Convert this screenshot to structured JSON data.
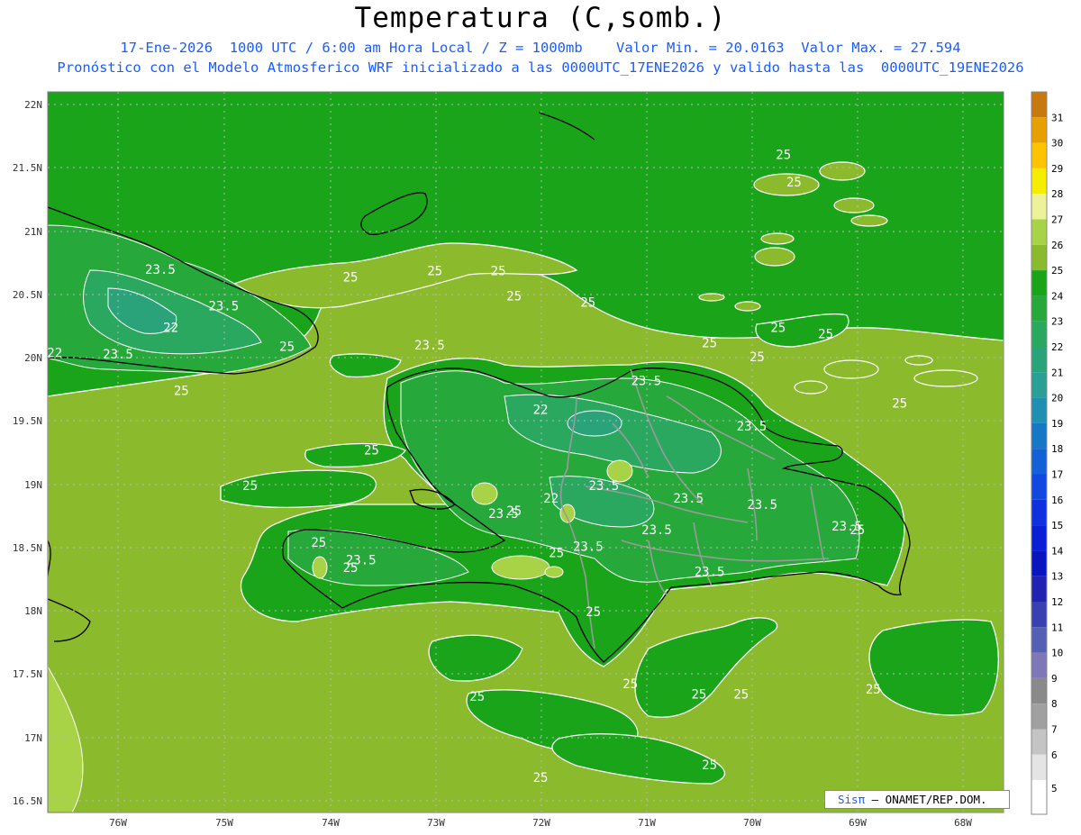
{
  "header": {
    "title": "Temperatura (C,somb.)",
    "line1": "17-Ene-2026  1000 UTC / 6:00 am Hora Local / Z = 1000mb    Valor Min. = 20.0163  Valor Max. = 27.594",
    "line2": "Pronóstico con el Modelo Atmosferico WRF inicializado a las 0000UTC_17ENE2026 y valido hasta las  0000UTC_19ENE2026"
  },
  "map": {
    "lat_labels": [
      "22N",
      "21.5N",
      "21N",
      "20.5N",
      "20N",
      "19.5N",
      "19N",
      "18.5N",
      "18N",
      "17.5N",
      "17N",
      "16.5N"
    ],
    "lon_labels": [
      "76W",
      "75W",
      "74W",
      "73W",
      "72W",
      "71W",
      "70W",
      "69W",
      "68W"
    ],
    "contour_labels": [
      {
        "t": "25",
        "lon": -73.0,
        "lat": 20.65
      },
      {
        "t": "25",
        "lon": -72.4,
        "lat": 20.65
      },
      {
        "t": "25",
        "lon": -73.8,
        "lat": 20.6
      },
      {
        "t": "25",
        "lon": -72.25,
        "lat": 20.45
      },
      {
        "t": "25",
        "lon": -71.55,
        "lat": 20.4
      },
      {
        "t": "25",
        "lon": -74.4,
        "lat": 20.05
      },
      {
        "t": "25",
        "lon": -75.4,
        "lat": 19.7
      },
      {
        "t": "25",
        "lon": -73.6,
        "lat": 19.23
      },
      {
        "t": "25",
        "lon": -74.75,
        "lat": 18.95
      },
      {
        "t": "25",
        "lon": -72.25,
        "lat": 18.75
      },
      {
        "t": "25",
        "lon": -73.8,
        "lat": 18.3
      },
      {
        "t": "25",
        "lon": -74.1,
        "lat": 18.5
      },
      {
        "t": "25",
        "lon": -71.85,
        "lat": 18.42
      },
      {
        "t": "25",
        "lon": -71.5,
        "lat": 17.95
      },
      {
        "t": "25",
        "lon": -72.6,
        "lat": 17.28
      },
      {
        "t": "25",
        "lon": -71.15,
        "lat": 17.38
      },
      {
        "t": "25",
        "lon": -70.5,
        "lat": 17.3
      },
      {
        "t": "25",
        "lon": -70.1,
        "lat": 17.3
      },
      {
        "t": "25",
        "lon": -68.85,
        "lat": 17.34
      },
      {
        "t": "25",
        "lon": -70.4,
        "lat": 16.74
      },
      {
        "t": "25",
        "lon": -72.0,
        "lat": 16.64
      },
      {
        "t": "25",
        "lon": -70.4,
        "lat": 20.08
      },
      {
        "t": "25",
        "lon": -69.75,
        "lat": 20.2
      },
      {
        "t": "25",
        "lon": -69.95,
        "lat": 19.97
      },
      {
        "t": "25",
        "lon": -69.3,
        "lat": 20.15
      },
      {
        "t": "25",
        "lon": -68.6,
        "lat": 19.6
      },
      {
        "t": "25",
        "lon": -69.7,
        "lat": 21.57
      },
      {
        "t": "25",
        "lon": -69.6,
        "lat": 21.35
      },
      {
        "t": "25",
        "lon": -69.0,
        "lat": 18.6
      },
      {
        "t": "23.5",
        "lon": -75.6,
        "lat": 20.66
      },
      {
        "t": "23.5",
        "lon": -75.0,
        "lat": 20.37
      },
      {
        "t": "23.5",
        "lon": -76.0,
        "lat": 19.99
      },
      {
        "t": "23.5",
        "lon": -73.05,
        "lat": 20.06
      },
      {
        "t": "23.5",
        "lon": -71.0,
        "lat": 19.78
      },
      {
        "t": "23.5",
        "lon": -70.0,
        "lat": 19.42
      },
      {
        "t": "23.5",
        "lon": -71.4,
        "lat": 18.95
      },
      {
        "t": "23.5",
        "lon": -72.35,
        "lat": 18.73
      },
      {
        "t": "23.5",
        "lon": -71.55,
        "lat": 18.47
      },
      {
        "t": "23.5",
        "lon": -73.7,
        "lat": 18.36
      },
      {
        "t": "23.5",
        "lon": -70.6,
        "lat": 18.85
      },
      {
        "t": "23.5",
        "lon": -69.9,
        "lat": 18.8
      },
      {
        "t": "23.5",
        "lon": -69.1,
        "lat": 18.63
      },
      {
        "t": "23.5",
        "lon": -70.4,
        "lat": 18.27
      },
      {
        "t": "23.5",
        "lon": -70.9,
        "lat": 18.6
      },
      {
        "t": "22",
        "lon": -75.5,
        "lat": 20.2
      },
      {
        "t": "22",
        "lon": -76.6,
        "lat": 20.0
      },
      {
        "t": "22",
        "lon": -72.0,
        "lat": 19.55
      },
      {
        "t": "22",
        "lon": -71.9,
        "lat": 18.85
      }
    ]
  },
  "colorbar": {
    "ticks": [
      "31",
      "30",
      "29",
      "28",
      "27",
      "26",
      "25",
      "24",
      "23",
      "22",
      "21",
      "20",
      "19",
      "18",
      "17",
      "16",
      "15",
      "14",
      "13",
      "12",
      "11",
      "10",
      "9",
      "8",
      "7",
      "6",
      "5"
    ],
    "colors": {
      "c31": "#c8780f",
      "c30": "#e8a000",
      "c29": "#ffc400",
      "c28": "#f6ee00",
      "c27": "#ecf29a",
      "c26": "#a9d346",
      "c25": "#8bba2c",
      "c24": "#19a419",
      "c23": "#27a83a",
      "c22": "#2aa860",
      "c21": "#2aa37b",
      "c20": "#2b9f95",
      "c19": "#1f8fb2",
      "c18": "#1577c5",
      "c17": "#1460d7",
      "c16": "#1248e2",
      "c15": "#1030e0",
      "c14": "#0a1ed6",
      "c13": "#0916bf",
      "c12": "#2222b0",
      "c11": "#3a3fb2",
      "c10": "#5560b4",
      "c9": "#7f78b6",
      "c8": "#8a8a8a",
      "c7": "#a0a0a0",
      "c6": "#c4c4c4",
      "c5": "#e4e4e4",
      "c4": "#ffffff"
    }
  },
  "credit": {
    "brand": "Sisπ",
    "text": " – ONAMET/REP.DOM."
  }
}
